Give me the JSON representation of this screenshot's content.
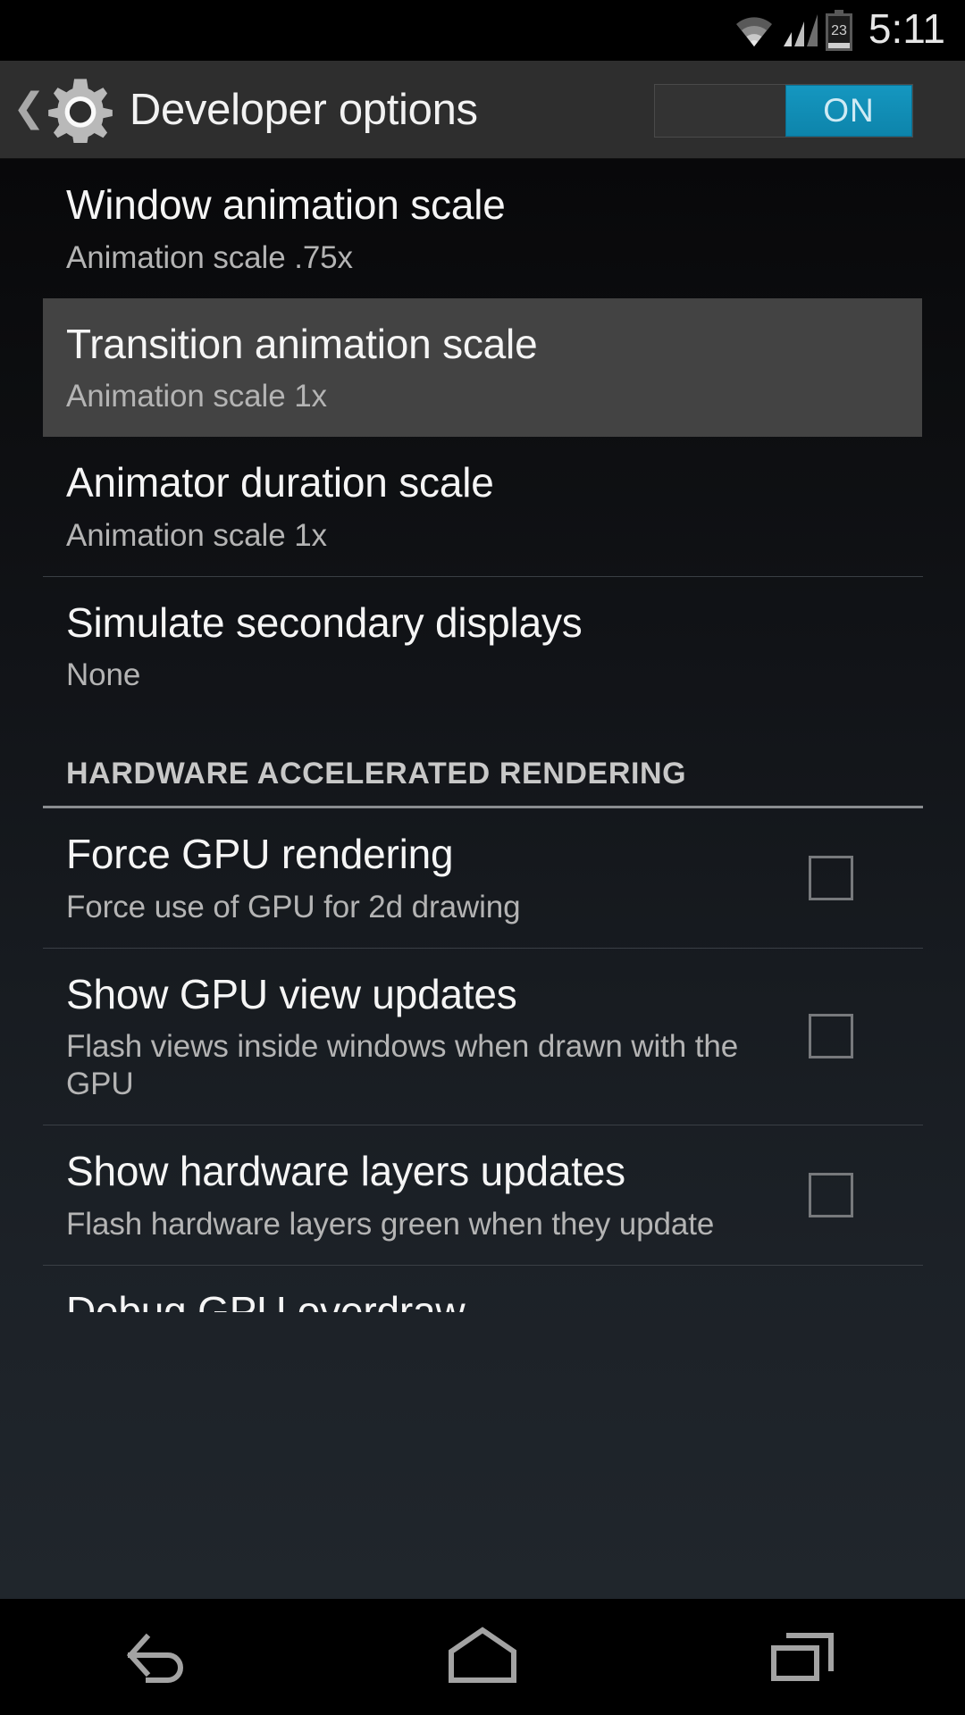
{
  "statusbar": {
    "time": "5:11",
    "battery_level": "23",
    "icons": [
      "wifi-icon",
      "signal-icon",
      "battery-icon"
    ]
  },
  "actionbar": {
    "back_icon": "back-chevron-icon",
    "app_icon": "gear-icon",
    "title": "Developer options",
    "toggle_label": "ON",
    "toggle_state": "on",
    "accent_color": "#0e8cb5"
  },
  "list": [
    {
      "title": "Window animation scale",
      "subtitle": "Animation scale .75x",
      "highlighted": false,
      "checkbox": false
    },
    {
      "title": "Transition animation scale",
      "subtitle": "Animation scale 1x",
      "highlighted": true,
      "checkbox": false
    },
    {
      "title": "Animator duration scale",
      "subtitle": "Animation scale 1x",
      "highlighted": false,
      "checkbox": false
    },
    {
      "title": "Simulate secondary displays",
      "subtitle": "None",
      "highlighted": false,
      "checkbox": false
    }
  ],
  "section": {
    "header": "HARDWARE ACCELERATED RENDERING"
  },
  "list2": [
    {
      "title": "Force GPU rendering",
      "subtitle": "Force use of GPU for 2d drawing",
      "checkbox": true,
      "checked": false
    },
    {
      "title": "Show GPU view updates",
      "subtitle": "Flash views inside windows when drawn with the GPU",
      "checkbox": true,
      "checked": false
    },
    {
      "title": "Show hardware layers updates",
      "subtitle": "Flash hardware layers green when they update",
      "checkbox": true,
      "checked": false
    }
  ],
  "partial_row": {
    "title": "Debug GPU overdraw"
  },
  "navbar": {
    "back": "back-nav-icon",
    "home": "home-nav-icon",
    "recents": "recents-nav-icon"
  },
  "colors": {
    "highlight_row": "#434343",
    "accent": "#0e8cb5",
    "divider": "#3a3f45"
  }
}
